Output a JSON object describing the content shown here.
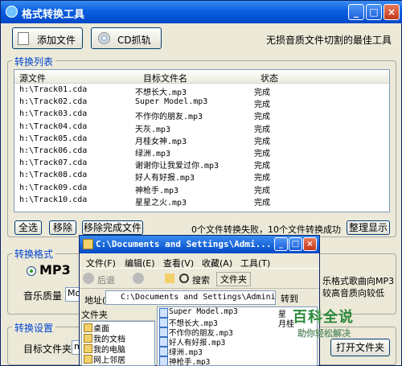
{
  "window": {
    "title": "格式转换工具",
    "controls": [
      "_",
      "□",
      "×"
    ]
  },
  "toolbar": {
    "add_file": "添加文件",
    "cd_grab": "CD抓轨",
    "slogan": "无损音质文件切割的最佳工具"
  },
  "list_group": {
    "label": "转换列表",
    "columns": [
      "源文件",
      "目标文件名",
      "状态"
    ],
    "rows": [
      [
        "h:\\Track01.cda",
        "不想长大.mp3",
        "完成"
      ],
      [
        "h:\\Track02.cda",
        "Super Model.mp3",
        "完成"
      ],
      [
        "h:\\Track03.cda",
        "不作你的朋友.mp3",
        "完成"
      ],
      [
        "h:\\Track04.cda",
        "天灰.mp3",
        "完成"
      ],
      [
        "h:\\Track05.cda",
        "月桂女神.mp3",
        "完成"
      ],
      [
        "h:\\Track06.cda",
        "绿洲.mp3",
        "完成"
      ],
      [
        "h:\\Track07.cda",
        "谢谢你让我爱过你.mp3",
        "完成"
      ],
      [
        "h:\\Track08.cda",
        "好人有好报.mp3",
        "完成"
      ],
      [
        "h:\\Track09.cda",
        "神枪手.mp3",
        "完成"
      ],
      [
        "h:\\Track10.cda",
        "星星之火.mp3",
        "完成"
      ]
    ]
  },
  "list_actions": {
    "select_all": "全选",
    "remove": "移除",
    "remove_done": "移除完成文件",
    "status": "0个文件转换失败，10个文件转换成功",
    "tidy": "整理显示"
  },
  "format_group": {
    "label": "转换格式",
    "format": "MP3",
    "quality_label": "音乐质量",
    "quality_value": "Mo",
    "desc_line1": "乐格式歌曲向MP3",
    "desc_line2": "较高音质向较低"
  },
  "settings_group": {
    "label": "转换设置",
    "target_folder_label": "目标文件夹",
    "target_folder_value": "me",
    "open_folder": "打开文件夹"
  },
  "explorer": {
    "title": "C:\\Documents and Settings\\Admi...",
    "menu": [
      "文件(F)",
      "编辑(E)",
      "查看(V)",
      "收藏(A)",
      "工具(T)"
    ],
    "toolbar": {
      "back": "后退",
      "search": "搜索",
      "folders": "文件夹"
    },
    "address_label": "地址(D)",
    "address": "C:\\Documents and Settings\\Administ",
    "go": "转到",
    "folders_header": "文件夹",
    "tree": [
      "桌面",
      "我的文档",
      "我的电脑",
      "网上邻居"
    ],
    "files": [
      "Super Model.mp3",
      "不想长大.mp3",
      "不作你的朋友.mp3",
      "好人有好报.mp3",
      "绿洲.mp3",
      "神枪手.mp3"
    ],
    "right_col": [
      "星",
      "月桂"
    ]
  },
  "watermark": {
    "big": "百科全说",
    "small": "助你轻松解决"
  }
}
